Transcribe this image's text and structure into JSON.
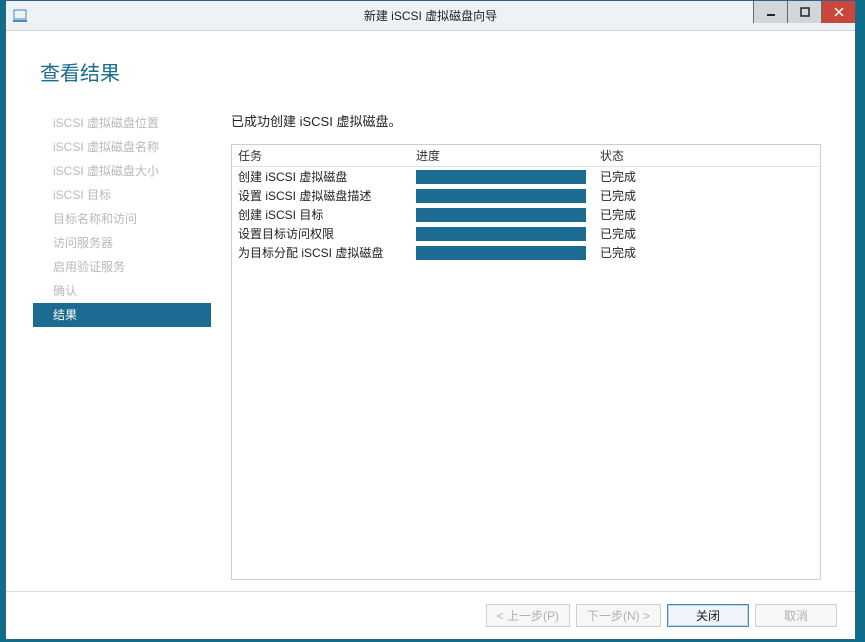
{
  "titlebar": {
    "title": "新建 iSCSI 虚拟磁盘向导"
  },
  "heading": "查看结果",
  "sidebar": {
    "items": [
      {
        "label": "iSCSI 虚拟磁盘位置",
        "selected": false
      },
      {
        "label": "iSCSI 虚拟磁盘名称",
        "selected": false
      },
      {
        "label": "iSCSI 虚拟磁盘大小",
        "selected": false
      },
      {
        "label": "iSCSI 目标",
        "selected": false
      },
      {
        "label": "目标名称和访问",
        "selected": false
      },
      {
        "label": "访问服务器",
        "selected": false
      },
      {
        "label": "启用验证服务",
        "selected": false
      },
      {
        "label": "确认",
        "selected": false
      },
      {
        "label": "结果",
        "selected": true
      }
    ]
  },
  "main": {
    "message": "已成功创建 iSCSI 虚拟磁盘。",
    "columns": {
      "task": "任务",
      "progress": "进度",
      "status": "状态"
    },
    "rows": [
      {
        "task": "创建 iSCSI 虚拟磁盘",
        "status": "已完成"
      },
      {
        "task": "设置 iSCSI 虚拟磁盘描述",
        "status": "已完成"
      },
      {
        "task": "创建 iSCSI 目标",
        "status": "已完成"
      },
      {
        "task": "设置目标访问权限",
        "status": "已完成"
      },
      {
        "task": "为目标分配 iSCSI 虚拟磁盘",
        "status": "已完成"
      }
    ]
  },
  "footer": {
    "back": "< 上一步(P)",
    "next": "下一步(N) >",
    "close": "关闭",
    "cancel": "取消"
  }
}
